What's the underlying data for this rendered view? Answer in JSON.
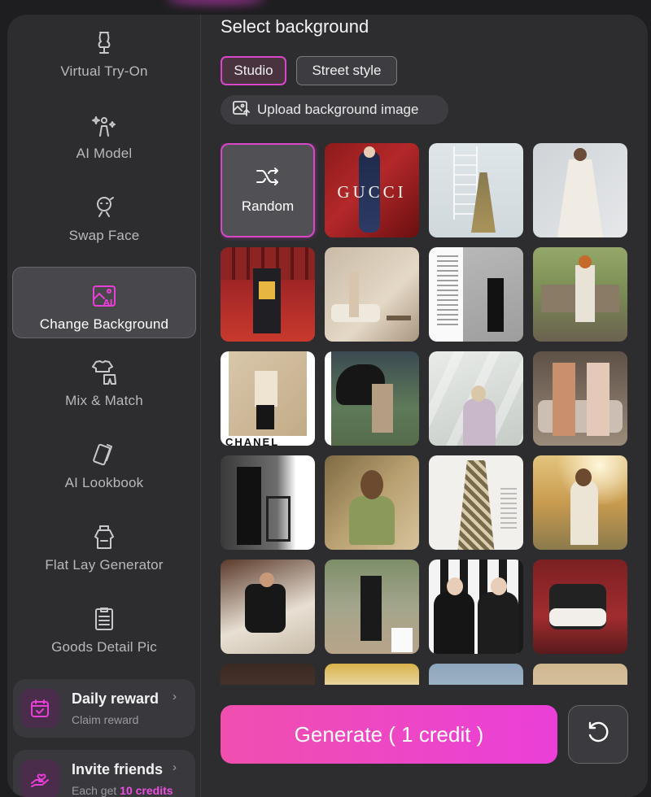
{
  "sidebar": {
    "items": [
      {
        "label": "Virtual Try-On",
        "icon": "dress-form-icon"
      },
      {
        "label": "AI Model",
        "icon": "sparkle-person-icon"
      },
      {
        "label": "Swap Face",
        "icon": "face-swap-icon"
      },
      {
        "label": "Change Background",
        "icon": "ai-image-icon",
        "active": true
      },
      {
        "label": "Mix & Match",
        "icon": "shirt-shorts-icon"
      },
      {
        "label": "AI Lookbook",
        "icon": "cards-icon"
      },
      {
        "label": "Flat Lay Generator",
        "icon": "flat-lay-icon"
      },
      {
        "label": "Goods Detail Pic",
        "icon": "clipboard-list-icon"
      }
    ],
    "daily_reward": {
      "title": "Daily reward",
      "subtitle": "Claim reward"
    },
    "invite": {
      "title": "Invite friends",
      "subtitle_prefix": "Each get",
      "subtitle_highlight": "10 credits"
    }
  },
  "main": {
    "title": "Select background",
    "tabs": [
      {
        "label": "Studio",
        "active": true
      },
      {
        "label": "Street style",
        "active": false
      }
    ],
    "upload_label": "Upload background image",
    "random_label": "Random",
    "tile_texts": {
      "gucci": "GUCCI",
      "chanel": "CHANEL"
    },
    "generate_label": "Generate ( 1 credit )"
  },
  "colors": {
    "accent": "#e83fd6",
    "panel": "#2d2d30",
    "generate_gradient_start": "#f04fae",
    "generate_gradient_end": "#eb3fd9"
  }
}
